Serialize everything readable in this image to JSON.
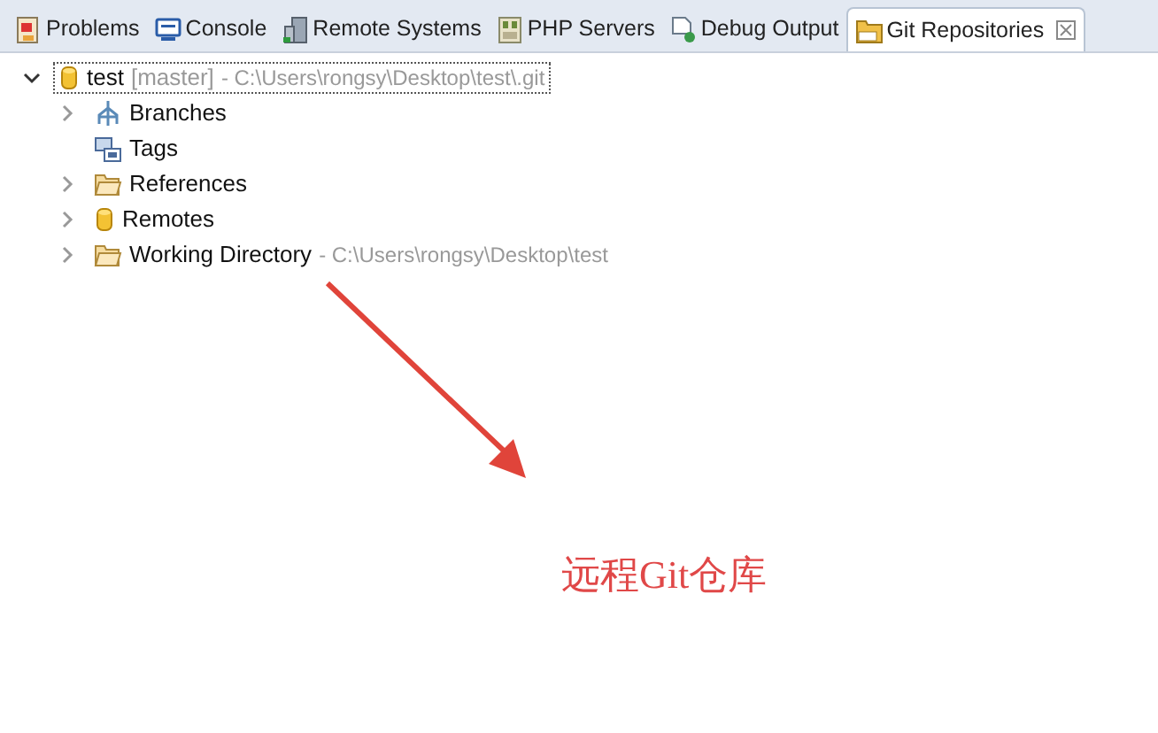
{
  "tabs": [
    {
      "label": "Problems",
      "kind": "problems",
      "selected": false
    },
    {
      "label": "Console",
      "kind": "console",
      "selected": false
    },
    {
      "label": "Remote Systems",
      "kind": "remote",
      "selected": false
    },
    {
      "label": "PHP Servers",
      "kind": "php",
      "selected": false
    },
    {
      "label": "Debug Output",
      "kind": "debug",
      "selected": false
    },
    {
      "label": "Git Repositories",
      "kind": "git",
      "selected": true
    }
  ],
  "tree": [
    {
      "label": "test",
      "kind": "repo",
      "branch": "[master]",
      "path": "- C:\\Users\\rongsy\\Desktop\\test\\.git",
      "expandable": true,
      "expanded": true,
      "selected": true,
      "children": [
        {
          "label": "Branches",
          "kind": "branches",
          "expandable": true,
          "expanded": false,
          "selected": false
        },
        {
          "label": "Tags",
          "kind": "tags",
          "expandable": false,
          "expanded": false,
          "selected": false
        },
        {
          "label": "References",
          "kind": "folder",
          "expandable": true,
          "expanded": false,
          "selected": false
        },
        {
          "label": "Remotes",
          "kind": "remote",
          "expandable": true,
          "expanded": false,
          "selected": false
        },
        {
          "label": "Working Directory",
          "kind": "folder",
          "path": "- C:\\Users\\rongsy\\Desktop\\test",
          "expandable": true,
          "expanded": false,
          "selected": false
        }
      ]
    }
  ],
  "annotation": {
    "text": "远程Git仓库"
  }
}
